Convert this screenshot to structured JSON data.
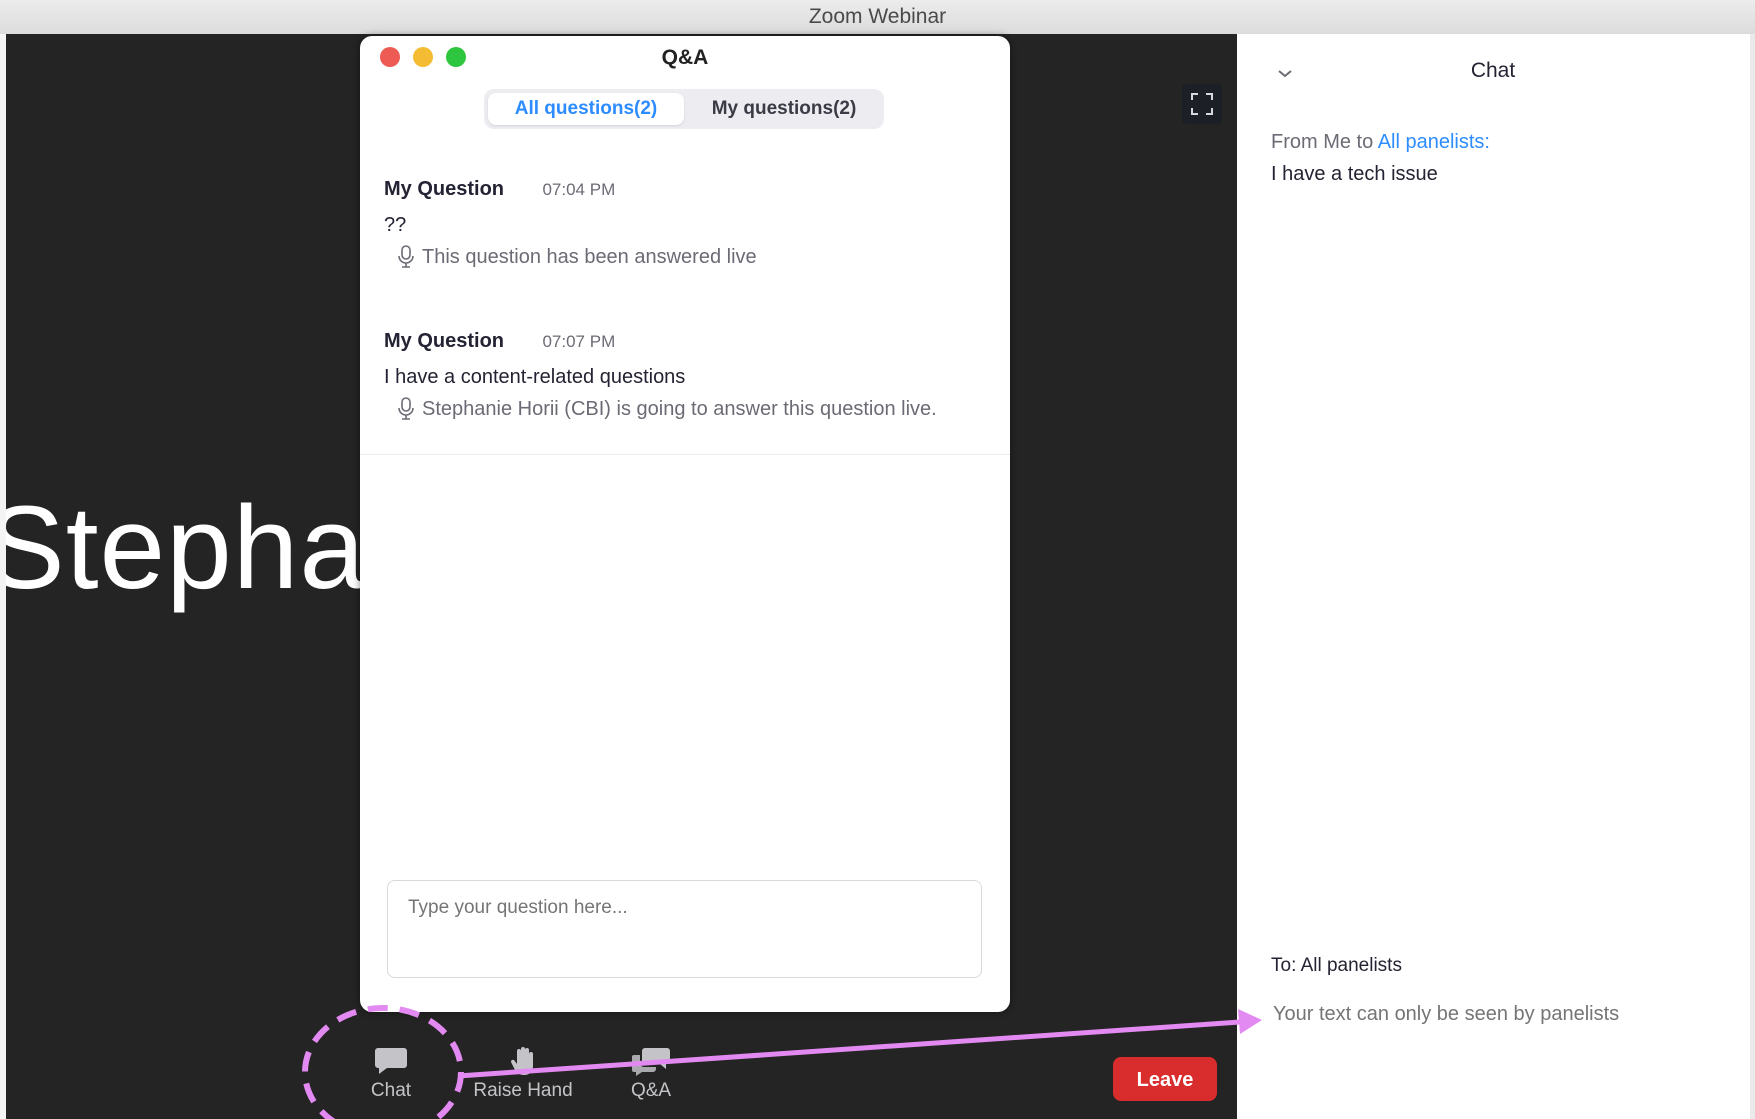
{
  "window": {
    "title": "Zoom Webinar"
  },
  "video": {
    "speaker_name": "Stephan"
  },
  "qa": {
    "title": "Q&A",
    "tabs": [
      {
        "label": "All questions(2)",
        "active": true
      },
      {
        "label": "My questions(2)",
        "active": false
      }
    ],
    "questions": [
      {
        "author": "My Question",
        "time": "07:04 PM",
        "text": "??",
        "status": "This question has been answered live"
      },
      {
        "author": "My Question",
        "time": "07:07 PM",
        "text": "I have a content-related questions",
        "status": "Stephanie Horii (CBI) is going to answer this question live."
      }
    ],
    "input_placeholder": "Type your question here..."
  },
  "toolbar": {
    "chat_label": "Chat",
    "raise_hand_label": "Raise Hand",
    "qa_label": "Q&A",
    "leave_label": "Leave"
  },
  "chat": {
    "title": "Chat",
    "message": {
      "from_prefix": "From Me to ",
      "recipient": "All panelists",
      "suffix": ":",
      "text": "I have a tech issue"
    },
    "to_label": "To: All panelists",
    "input_placeholder": "Your text can only be seen by panelists"
  },
  "annotation": {
    "color": "#e389f2"
  },
  "colors": {
    "accent": "#2d8cff",
    "leave": "#d92c2c",
    "video_bg": "#242424"
  }
}
